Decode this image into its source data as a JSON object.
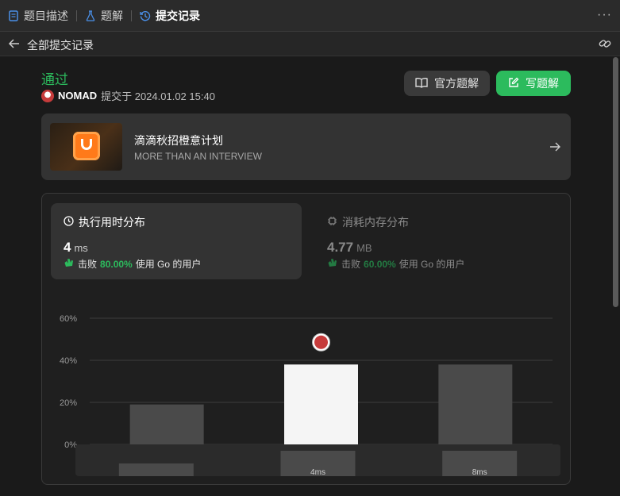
{
  "tabs": [
    {
      "label": "题目描述",
      "icon": "document-icon"
    },
    {
      "label": "题解",
      "icon": "flask-icon"
    },
    {
      "label": "提交记录",
      "icon": "history-icon"
    }
  ],
  "subheader": {
    "title": "全部提交记录"
  },
  "submission": {
    "status": "通过",
    "username": "NOMAD",
    "submitted_text": "提交于 2024.01.02 15:40"
  },
  "buttons": {
    "official": "官方题解",
    "write": "写题解"
  },
  "banner": {
    "title": "滴滴秋招橙意计划",
    "subtitle": "MORE THAN AN INTERVIEW"
  },
  "runtime": {
    "title": "执行用时分布",
    "value": "4",
    "unit": "ms",
    "beat_prefix": "击败",
    "beat_pct": "80.00%",
    "beat_suffix": "使用 Go 的用户"
  },
  "memory": {
    "title": "消耗内存分布",
    "value": "4.77",
    "unit": "MB",
    "beat_prefix": "击败",
    "beat_pct": "60.00%",
    "beat_suffix": "使用 Go 的用户"
  },
  "colors": {
    "accent": "#2cbb5d",
    "bar": "#4a4a4a",
    "bar_active": "#f5f5f5"
  },
  "chart_data": {
    "type": "bar",
    "categories": [
      "",
      "4ms",
      "8ms"
    ],
    "values": [
      19,
      38,
      38
    ],
    "highlight_index": 1,
    "ylim": [
      0,
      60
    ],
    "yticks": [
      "0%",
      "20%",
      "40%",
      "60%"
    ],
    "grid": true,
    "mini_labels": [
      "",
      "4ms",
      "8ms"
    ]
  }
}
